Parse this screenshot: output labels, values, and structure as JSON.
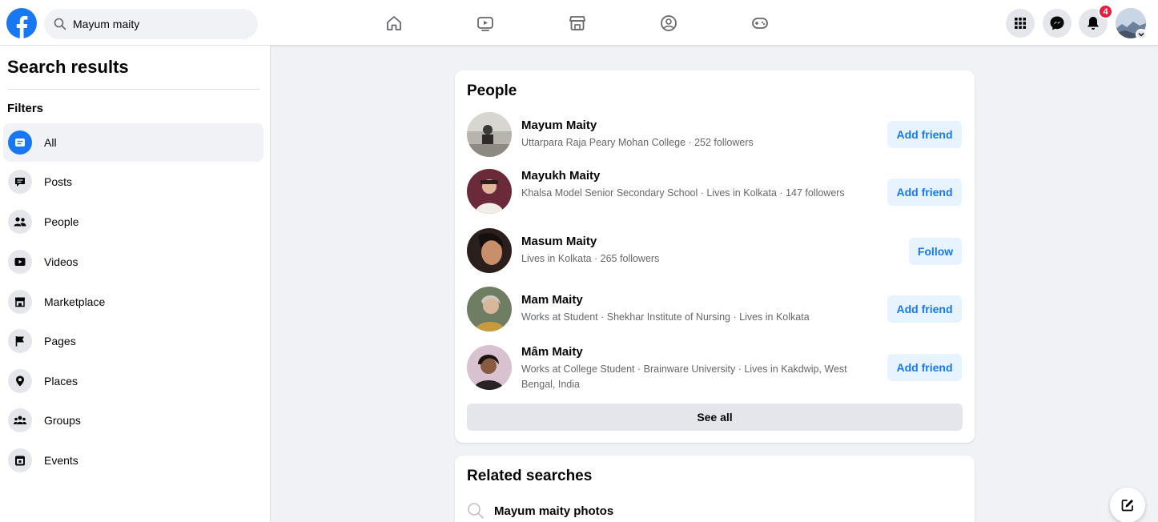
{
  "header": {
    "search": {
      "value": "Mayum maity"
    },
    "nav_icons": [
      "home-icon",
      "watch-icon",
      "marketplace-icon",
      "groups-icon",
      "gaming-icon"
    ],
    "notification_count": "4",
    "accent_color": "#1877f2"
  },
  "sidebar": {
    "title": "Search results",
    "filters_label": "Filters",
    "items": [
      {
        "label": "All",
        "icon": "all-icon",
        "active": true
      },
      {
        "label": "Posts",
        "icon": "posts-icon"
      },
      {
        "label": "People",
        "icon": "people-icon"
      },
      {
        "label": "Videos",
        "icon": "videos-icon"
      },
      {
        "label": "Marketplace",
        "icon": "marketplace-icon"
      },
      {
        "label": "Pages",
        "icon": "flag-icon"
      },
      {
        "label": "Places",
        "icon": "pin-icon"
      },
      {
        "label": "Groups",
        "icon": "groups-icon"
      },
      {
        "label": "Events",
        "icon": "calendar-icon"
      }
    ]
  },
  "people": {
    "title": "People",
    "results": [
      {
        "name": "Mayum Maity",
        "meta": "Uttarpara Raja Peary Mohan College · 252 followers",
        "action": "Add friend"
      },
      {
        "name": "Mayukh Maity",
        "meta": "Khalsa Model Senior Secondary School · Lives in Kolkata · 147 followers",
        "action": "Add friend"
      },
      {
        "name": "Masum Maity",
        "meta": "Lives in Kolkata · 265 followers",
        "action": "Follow"
      },
      {
        "name": "Mam Maity",
        "meta": "Works at Student · Shekhar Institute of Nursing · Lives in Kolkata",
        "action": "Add friend"
      },
      {
        "name": "Mâm Maity",
        "meta": "Works at College Student · Brainware University · Lives in Kakdwip, West Bengal, India",
        "action": "Add friend"
      }
    ],
    "see_all": "See all"
  },
  "related": {
    "title": "Related searches",
    "items": [
      {
        "text": "Mayum maity photos"
      }
    ]
  }
}
